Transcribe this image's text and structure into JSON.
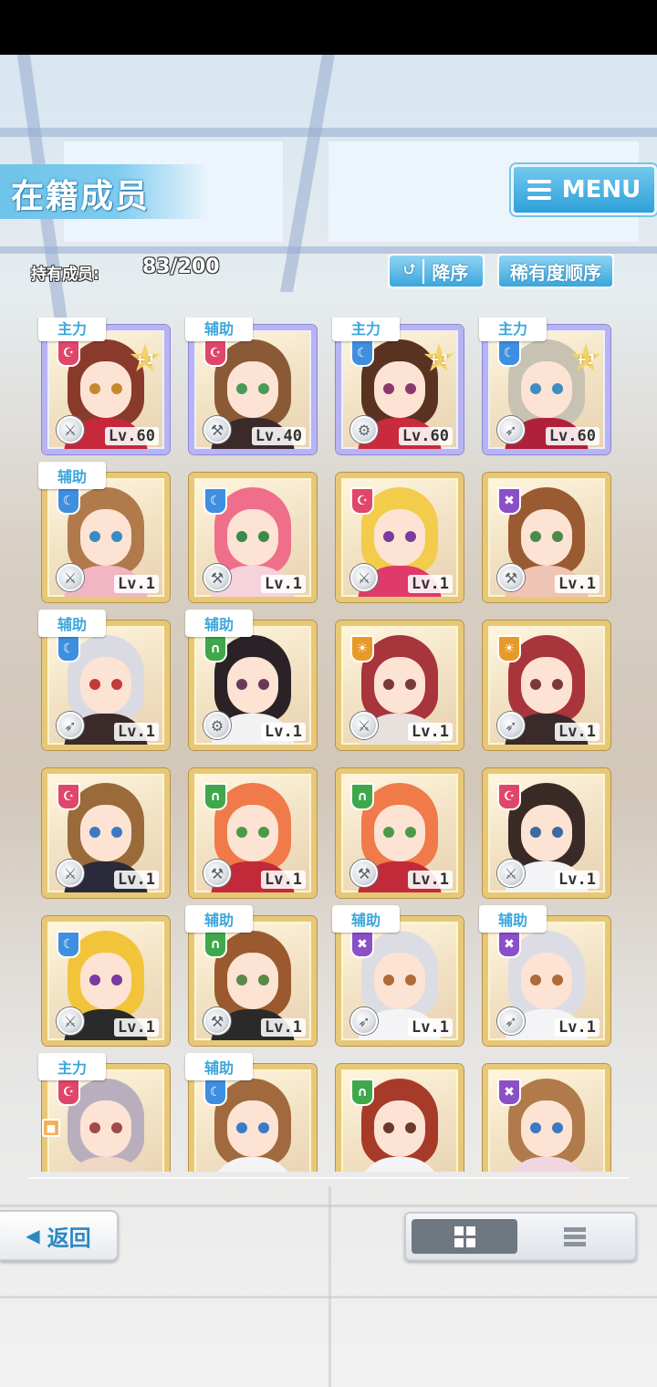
{
  "header": {
    "title": "在籍成员",
    "menu_label": "MENU"
  },
  "member_count": {
    "label": "持有成员:",
    "value": "83/200"
  },
  "sort": {
    "order_label": "降序",
    "rarity_label": "稀有度顺序"
  },
  "footer": {
    "back_label": "返回"
  },
  "colors": {
    "accent_blue": "#3ba6dd",
    "frame_gold": "#e7c878",
    "frame_rainbow": "#b8b3f2",
    "attr_red": "#e0466a",
    "attr_blue": "#3f8fe0",
    "attr_green": "#3ea84a",
    "attr_purple": "#8b4fc8",
    "attr_orange": "#e89a28"
  },
  "cards": [
    {
      "tag": "主力",
      "attr": "red",
      "plus": "+1",
      "level": "Lv.60",
      "frame": "rainbow",
      "weapon": "sword-icon",
      "hair": "#8a3a2a",
      "eyes": "#c48a2e",
      "outfit": "#c4283a"
    },
    {
      "tag": "辅助",
      "attr": "red",
      "plus": "",
      "level": "Lv.40",
      "frame": "rainbow",
      "weapon": "hammer-icon",
      "hair": "#8a5a36",
      "eyes": "#4a9a5a",
      "outfit": "#3a2a2a"
    },
    {
      "tag": "主力",
      "attr": "blue",
      "plus": "+1",
      "level": "Lv.60",
      "frame": "rainbow",
      "weapon": "gear-icon",
      "hair": "#5a3222",
      "eyes": "#8a3a6a",
      "outfit": "#c92a3c"
    },
    {
      "tag": "主力",
      "attr": "blue",
      "plus": "+1",
      "level": "Lv.60",
      "frame": "rainbow",
      "weapon": "gun-icon",
      "hair": "#c8c2b2",
      "eyes": "#3e8ec0",
      "outfit": "#b0203a"
    },
    {
      "tag": "辅助",
      "attr": "blue",
      "plus": "",
      "level": "Lv.1",
      "frame": "gold",
      "weapon": "sword-icon",
      "hair": "#b07a4a",
      "eyes": "#3a8ac4",
      "outfit": "#f1b6c2"
    },
    {
      "tag": "",
      "attr": "blue",
      "plus": "",
      "level": "Lv.1",
      "frame": "gold",
      "weapon": "hammer-icon",
      "hair": "#ef6f8a",
      "eyes": "#3b8a4a",
      "outfit": "#f5d2dc"
    },
    {
      "tag": "",
      "attr": "red",
      "plus": "",
      "level": "Lv.1",
      "frame": "gold",
      "weapon": "sword-icon",
      "hair": "#f2cc4a",
      "eyes": "#7a3aa0",
      "outfit": "#e03a6a"
    },
    {
      "tag": "",
      "attr": "purple",
      "plus": "",
      "level": "Lv.1",
      "frame": "gold",
      "weapon": "hammer-icon",
      "hair": "#9a5a32",
      "eyes": "#4a8a4a",
      "outfit": "#f0c4b4"
    },
    {
      "tag": "辅助",
      "attr": "blue",
      "plus": "",
      "level": "Lv.1",
      "frame": "gold",
      "weapon": "gun-icon",
      "hair": "#dadae2",
      "eyes": "#c23a3a",
      "outfit": "#3a2a2a"
    },
    {
      "tag": "辅助",
      "attr": "green",
      "plus": "",
      "level": "Lv.1",
      "frame": "gold",
      "weapon": "gear-icon",
      "hair": "#2a2226",
      "eyes": "#6a3a5a",
      "outfit": "#f2f2f2"
    },
    {
      "tag": "",
      "attr": "orange",
      "plus": "",
      "level": "Lv.1",
      "frame": "gold",
      "weapon": "sword-icon",
      "hair": "#a8343c",
      "eyes": "#7a3a3a",
      "outfit": "#e8e0da"
    },
    {
      "tag": "",
      "attr": "orange",
      "plus": "",
      "level": "Lv.1",
      "frame": "gold",
      "weapon": "gun-icon",
      "hair": "#a8343c",
      "eyes": "#7a3a3a",
      "outfit": "#3a2a2a"
    },
    {
      "tag": "",
      "attr": "red",
      "plus": "",
      "level": "Lv.1",
      "frame": "gold",
      "weapon": "sword-icon",
      "hair": "#9a6a3a",
      "eyes": "#3a7ac4",
      "outfit": "#2a2a3a"
    },
    {
      "tag": "",
      "attr": "green",
      "plus": "",
      "level": "Lv.1",
      "frame": "gold",
      "weapon": "hammer-icon",
      "hair": "#f07a4a",
      "eyes": "#4a9a4a",
      "outfit": "#c22a3a"
    },
    {
      "tag": "",
      "attr": "green",
      "plus": "",
      "level": "Lv.1",
      "frame": "gold",
      "weapon": "hammer-icon",
      "hair": "#f07a4a",
      "eyes": "#4a9a4a",
      "outfit": "#c22a3a"
    },
    {
      "tag": "",
      "attr": "red",
      "plus": "",
      "level": "Lv.1",
      "frame": "gold",
      "weapon": "sword-icon",
      "hair": "#3a2a26",
      "eyes": "#3a6aa0",
      "outfit": "#f4f4f6"
    },
    {
      "tag": "",
      "attr": "blue",
      "plus": "",
      "level": "Lv.1",
      "frame": "gold",
      "weapon": "sword-icon",
      "hair": "#f2c43a",
      "eyes": "#7a3aa0",
      "outfit": "#2a2a2a"
    },
    {
      "tag": "辅助",
      "attr": "green",
      "plus": "",
      "level": "Lv.1",
      "frame": "gold",
      "weapon": "hammer-icon",
      "hair": "#9a5a2e",
      "eyes": "#5a8a4a",
      "outfit": "#2a2a2a"
    },
    {
      "tag": "辅助",
      "attr": "purple",
      "plus": "",
      "level": "Lv.1",
      "frame": "gold",
      "weapon": "gun-icon",
      "hair": "#dcdce4",
      "eyes": "#b06a3a",
      "outfit": "#f4f4f6"
    },
    {
      "tag": "辅助",
      "attr": "purple",
      "plus": "",
      "level": "Lv.1",
      "frame": "gold",
      "weapon": "gun-icon",
      "hair": "#dcdce4",
      "eyes": "#b06a3a",
      "outfit": "#f4f4f6"
    },
    {
      "tag": "主力",
      "attr": "red",
      "plus": "",
      "level": "",
      "frame": "gold",
      "weapon": "",
      "lock": true,
      "hair": "#b8aebe",
      "eyes": "#a04a4a",
      "outfit": "#f0d6c4"
    },
    {
      "tag": "辅助",
      "attr": "blue",
      "plus": "",
      "level": "",
      "frame": "gold",
      "weapon": "",
      "hair": "#a06a3e",
      "eyes": "#3a7ac4",
      "outfit": "#f4f4f6"
    },
    {
      "tag": "",
      "attr": "green",
      "plus": "",
      "level": "",
      "frame": "gold",
      "weapon": "",
      "hair": "#a83a2a",
      "eyes": "#6a3a2a",
      "outfit": "#f4f4f6"
    },
    {
      "tag": "",
      "attr": "purple",
      "plus": "",
      "level": "",
      "frame": "gold",
      "weapon": "",
      "hair": "#b07a4a",
      "eyes": "#3a7ac4",
      "outfit": "#f0d6e0"
    }
  ]
}
